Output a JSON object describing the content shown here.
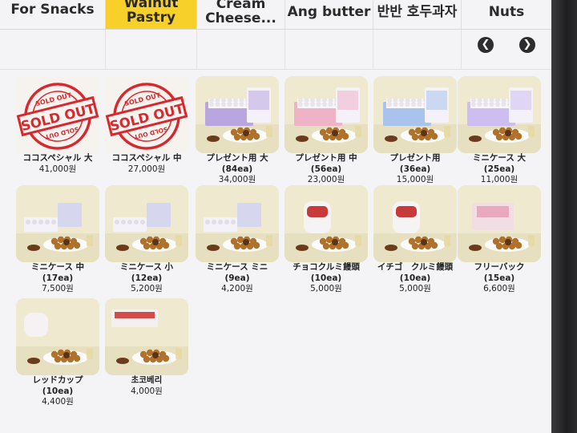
{
  "tabs": [
    {
      "lines": [
        "For Snacks"
      ],
      "active": false
    },
    {
      "lines": [
        "Walnut",
        "Pastry"
      ],
      "active": true
    },
    {
      "lines": [
        "Cream",
        "Cheese..."
      ],
      "active": false
    },
    {
      "lines": [
        "Ang butter"
      ],
      "active": false
    },
    {
      "lines": [
        "반반 호두과자"
      ],
      "active": false
    },
    {
      "lines": [
        "Nuts"
      ],
      "active": false
    }
  ],
  "nav": {
    "prev_icon": "chevron-left-icon",
    "next_icon": "chevron-right-icon"
  },
  "sold_out": {
    "top": "SOLD OUT",
    "main": "SOLD OUT",
    "bottom": "SOLD OUT"
  },
  "products": [
    {
      "name": "ココスペシャル 大",
      "qty": "",
      "price": "41,000원",
      "sold_out": true
    },
    {
      "name": "ココスペシャル 中",
      "qty": "",
      "price": "27,000원",
      "sold_out": true
    },
    {
      "name": "プレゼント用 大",
      "qty": "(84ea)",
      "price": "34,000원",
      "sold_out": false
    },
    {
      "name": "プレゼント用 中",
      "qty": "(56ea)",
      "price": "23,000원",
      "sold_out": false
    },
    {
      "name": "プレゼント用",
      "qty": "(36ea)",
      "price": "15,000원",
      "sold_out": false
    },
    {
      "name": "ミニケース 大",
      "qty": "(25ea)",
      "price": "11,000원",
      "sold_out": false
    },
    {
      "name": "ミニケース 中",
      "qty": "(17ea)",
      "price": "7,500원",
      "sold_out": false
    },
    {
      "name": "ミニケース 小",
      "qty": "(12ea)",
      "price": "5,200원",
      "sold_out": false
    },
    {
      "name": "ミニケース ミニ",
      "qty": "(9ea)",
      "price": "4,200원",
      "sold_out": false
    },
    {
      "name": "チョコクルミ饅頭",
      "qty": "(10ea)",
      "price": "5,000원",
      "sold_out": false
    },
    {
      "name": "イチゴ　クルミ饅頭",
      "qty": "(10ea)",
      "price": "5,000원",
      "sold_out": false
    },
    {
      "name": "フリーバック",
      "qty": "(15ea)",
      "price": "6,600원",
      "sold_out": false
    },
    {
      "name": "レッドカップ",
      "qty": "(10ea)",
      "price": "4,400원",
      "sold_out": false
    },
    {
      "name": "초코베리",
      "qty": "",
      "price": "4,000원",
      "sold_out": false
    }
  ],
  "colors": {
    "accent": "#f7d12a",
    "stamp_red": "#d8282f",
    "photo_bg": "#ece8cf"
  }
}
